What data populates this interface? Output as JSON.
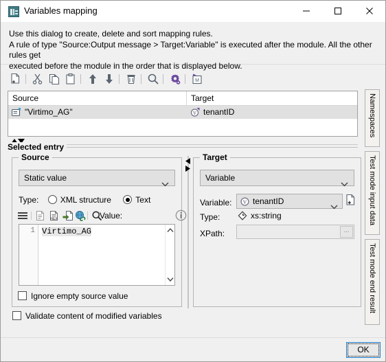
{
  "window": {
    "title": "Variables mapping",
    "icon": "variables-mapping-icon",
    "minimize_label": "—",
    "maximize_label": "□",
    "close_label": "✕"
  },
  "description": {
    "line1": "Use this dialog to create, delete and sort mapping rules.",
    "line2": "A rule of type \"Source:Output message > Target:Variable\" is executed after the module. All the other rules get",
    "line3": "executed before the module in the order that is displayed below."
  },
  "toolbar": {
    "items": [
      {
        "name": "new-rule-icon",
        "tooltip": "New"
      },
      {
        "name": "cut-icon",
        "tooltip": "Cut"
      },
      {
        "name": "copy-icon",
        "tooltip": "Copy"
      },
      {
        "name": "paste-icon",
        "tooltip": "Paste"
      },
      {
        "name": "move-up-icon",
        "tooltip": "Move up"
      },
      {
        "name": "move-down-icon",
        "tooltip": "Move down"
      },
      {
        "name": "delete-icon",
        "tooltip": "Delete"
      },
      {
        "name": "search-icon",
        "tooltip": "Search"
      },
      {
        "name": "settings-icon",
        "tooltip": "Settings"
      },
      {
        "name": "module-icon",
        "tooltip": "Module"
      }
    ]
  },
  "table": {
    "columns": [
      "Source",
      "Target"
    ],
    "rows": [
      {
        "source": "\"Virtimo_AG\"",
        "target": "tenantID",
        "selected": true
      }
    ]
  },
  "selected_entry": {
    "group_label": "Selected entry",
    "source": {
      "group_label": "Source",
      "mode": "Static value",
      "type_label": "Type:",
      "type_options": [
        "XML structure",
        "Text"
      ],
      "type_selected": "Text",
      "value_label": "Value:",
      "editor": {
        "line_number": "1",
        "content": "Virtimo_AG"
      },
      "ignore_empty_label": "Ignore empty source value",
      "ignore_empty_checked": false
    },
    "target": {
      "group_label": "Target",
      "mode": "Variable",
      "variable_label": "Variable:",
      "variable_value": "tenantID",
      "type_label": "Type:",
      "type_value": "xs:string",
      "xpath_label": "XPath:",
      "xpath_value": "",
      "xpath_browse_label": "...",
      "new_variable_icon": "new-variable-icon"
    }
  },
  "validate": {
    "label": "Validate content of modified variables",
    "checked": false
  },
  "side_tabs": [
    {
      "label": "Namespaces",
      "name": "tab-namespaces"
    },
    {
      "label": "Test mode input data",
      "name": "tab-test-mode-input-data"
    },
    {
      "label": "Test mode end result",
      "name": "tab-test-mode-end-result"
    }
  ],
  "footer": {
    "ok_label": "OK"
  },
  "colors": {
    "dialog_bg": "#f0f0f0",
    "titlebar_bg": "#ffffff",
    "selected_row": "#e0e0e0",
    "focus_blue": "#1a7fd4",
    "icon_gray": "#5a6570",
    "icon_purple": "#6b4a9e"
  }
}
